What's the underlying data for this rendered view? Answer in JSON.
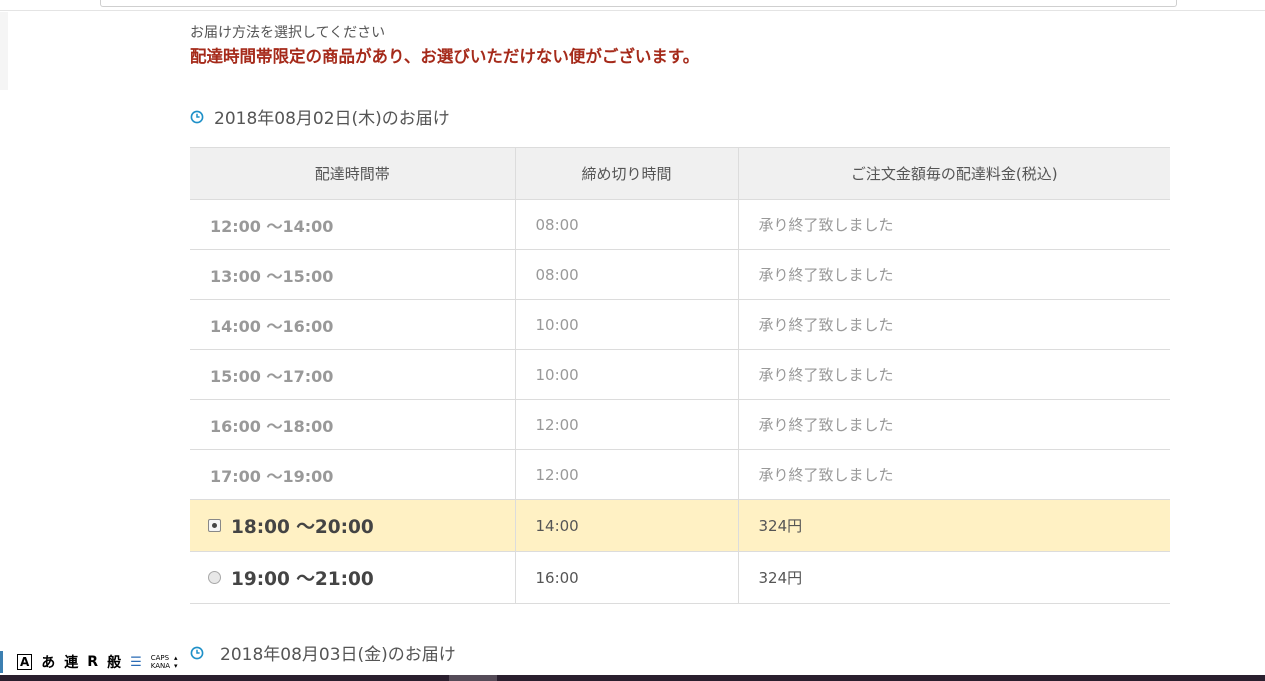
{
  "header": {
    "instruction": "お届け方法を選択してください",
    "warning": "配達時間帯限定の商品があり、お選びいただけない便がございます。"
  },
  "delivery_day_1": {
    "date_label": "2018年08月02日(木)のお届け",
    "columns": [
      "配達時間帯",
      "締め切り時間",
      "ご注文金額毎の配達料金(税込)"
    ],
    "rows": [
      {
        "slot": "12:00 〜14:00",
        "deadline": "08:00",
        "fee": "承り終了致しました"
      },
      {
        "slot": "13:00 〜15:00",
        "deadline": "08:00",
        "fee": "承り終了致しました"
      },
      {
        "slot": "14:00 〜16:00",
        "deadline": "10:00",
        "fee": "承り終了致しました"
      },
      {
        "slot": "15:00 〜17:00",
        "deadline": "10:00",
        "fee": "承り終了致しました"
      },
      {
        "slot": "16:00 〜18:00",
        "deadline": "12:00",
        "fee": "承り終了致しました"
      },
      {
        "slot": "17:00 〜19:00",
        "deadline": "12:00",
        "fee": "承り終了致しました"
      },
      {
        "slot": "18:00 〜20:00",
        "deadline": "14:00",
        "fee": "324円"
      },
      {
        "slot": "19:00 〜21:00",
        "deadline": "16:00",
        "fee": "324円"
      }
    ]
  },
  "delivery_day_2": {
    "date_label": "2018年08月03日(金)のお届け"
  },
  "ime_toolbar": {
    "input_mode": "あ",
    "conversion": "連",
    "r_label": "R",
    "dict": "般",
    "caps": "CAPS",
    "kana": "KANA"
  },
  "colors": {
    "warning": "#a52a1a",
    "selected_row": "#fff1c4",
    "clock_icon": "#1e90c8",
    "header_bg": "#f0f0f0"
  }
}
